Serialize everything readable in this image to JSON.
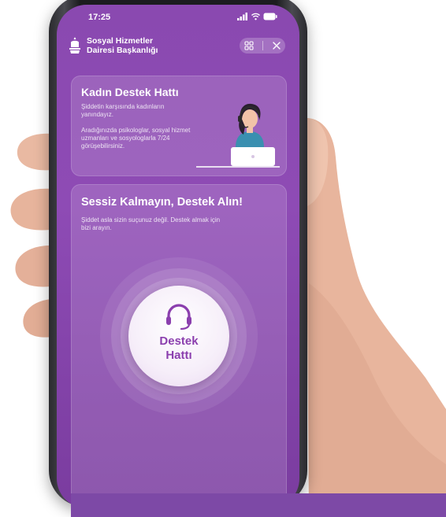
{
  "status_bar": {
    "time": "17:25"
  },
  "header": {
    "org_line1": "Sosyal Hizmetler",
    "org_line2": "Dairesi Başkanlığı"
  },
  "support_card": {
    "title": "Kadın Destek Hattı",
    "text1": "Şiddetin karşısında kadınların yanındayız.",
    "text2": "Aradığınızda psikologlar, sosyal hizmet uzmanları ve sosyologlarla 7/24 görüşebilirsiniz."
  },
  "call_card": {
    "title": "Sessiz Kalmayın, Destek Alın!",
    "text": "Şiddet asla sizin suçunuz değil. Destek almak için bizi arayın.",
    "button_line1": "Destek",
    "button_line2": "Hattı"
  },
  "colors": {
    "screen": "#8a49b0",
    "accent": "#8b3fae",
    "bottom_bar": "#7d49a6"
  },
  "icons": [
    "signal-icon",
    "wifi-icon",
    "battery-icon",
    "logo-icon",
    "grid-icon",
    "close-icon",
    "headset-icon",
    "agent-illustration"
  ]
}
